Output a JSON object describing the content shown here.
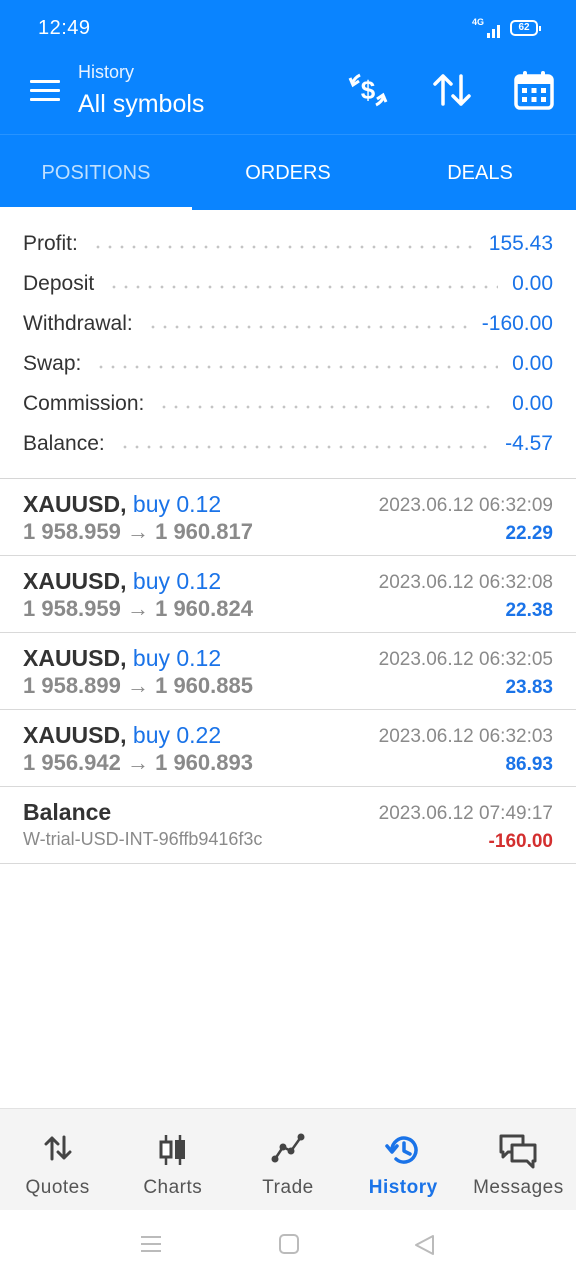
{
  "status": {
    "time": "12:49",
    "network": "4G",
    "battery": "62"
  },
  "header": {
    "subtitle": "History",
    "title": "All symbols"
  },
  "tabs": [
    {
      "label": "POSITIONS",
      "active": false
    },
    {
      "label": "ORDERS",
      "active": false
    },
    {
      "label": "DEALS",
      "active": true
    }
  ],
  "summary": [
    {
      "label": "Profit:",
      "value": "155.43"
    },
    {
      "label": "Deposit",
      "value": "0.00"
    },
    {
      "label": "Withdrawal:",
      "value": "-160.00"
    },
    {
      "label": "Swap:",
      "value": "0.00"
    },
    {
      "label": "Commission:",
      "value": "0.00"
    },
    {
      "label": "Balance:",
      "value": "-4.57"
    }
  ],
  "deals": [
    {
      "symbol": "XAUUSD,",
      "side": "buy 0.12",
      "prices": "1 958.959 → 1 960.817",
      "time": "2023.06.12 06:32:09",
      "profit": "22.29"
    },
    {
      "symbol": "XAUUSD,",
      "side": "buy 0.12",
      "prices": "1 958.959 → 1 960.824",
      "time": "2023.06.12 06:32:08",
      "profit": "22.38"
    },
    {
      "symbol": "XAUUSD,",
      "side": "buy 0.12",
      "prices": "1 958.899 → 1 960.885",
      "time": "2023.06.12 06:32:05",
      "profit": "23.83"
    },
    {
      "symbol": "XAUUSD,",
      "side": "buy 0.22",
      "prices": "1 956.942 → 1 960.893",
      "time": "2023.06.12 06:32:03",
      "profit": "86.93"
    }
  ],
  "balance_entry": {
    "label": "Balance",
    "comment": "W-trial-USD-INT-96ffb9416f3c",
    "time": "2023.06.12 07:49:17",
    "amount": "-160.00"
  },
  "bottom_nav": [
    {
      "label": "Quotes",
      "icon": "quotes-icon"
    },
    {
      "label": "Charts",
      "icon": "charts-icon"
    },
    {
      "label": "Trade",
      "icon": "trade-icon"
    },
    {
      "label": "History",
      "icon": "history-icon",
      "active": true
    },
    {
      "label": "Messages",
      "icon": "messages-icon"
    }
  ],
  "colors": {
    "primary": "#0a84ff",
    "positive": "#1a73e8",
    "negative": "#d32f2f"
  }
}
